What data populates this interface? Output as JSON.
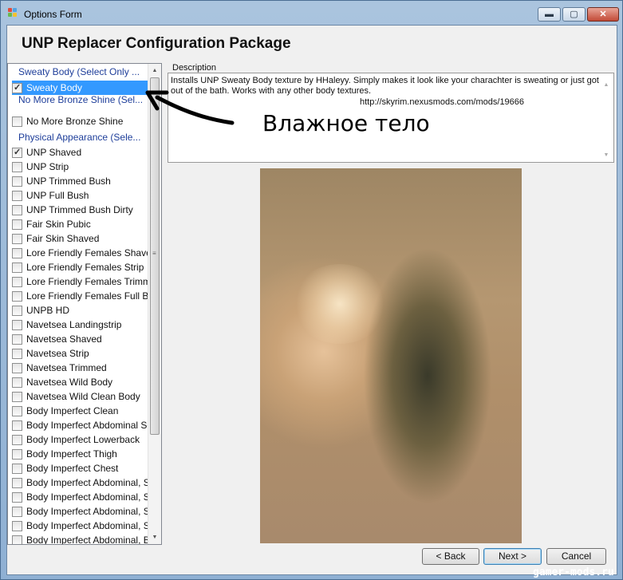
{
  "window": {
    "title": "Options Form",
    "controls": {
      "minimize": "▬",
      "maximize": "▢",
      "close": "✕"
    }
  },
  "form": {
    "title": "UNP Replacer Configuration Package"
  },
  "options_list": {
    "groups": [
      "Sweaty Body (Select Only ...",
      "No More Bronze Shine (Sel...",
      "Physical Appearance (Sele..."
    ],
    "items": [
      {
        "label": "Sweaty Body",
        "checked": true,
        "selected": true
      },
      {
        "label": "No More Bronze Shine",
        "checked": false
      },
      {
        "label": "UNP Shaved",
        "checked": true
      },
      {
        "label": "UNP Strip",
        "checked": false
      },
      {
        "label": "UNP Trimmed Bush",
        "checked": false
      },
      {
        "label": "UNP Full Bush",
        "checked": false
      },
      {
        "label": "UNP Trimmed Bush Dirty",
        "checked": false
      },
      {
        "label": "Fair Skin Pubic",
        "checked": false
      },
      {
        "label": "Fair Skin Shaved",
        "checked": false
      },
      {
        "label": "Lore Friendly Females Shaved",
        "checked": false
      },
      {
        "label": "Lore Friendly Females Strip",
        "checked": false
      },
      {
        "label": "Lore Friendly Females Trimme...",
        "checked": false
      },
      {
        "label": "Lore Friendly Females Full Bush",
        "checked": false
      },
      {
        "label": "UNPB HD",
        "checked": false
      },
      {
        "label": "Navetsea Landingstrip",
        "checked": false
      },
      {
        "label": "Navetsea Shaved",
        "checked": false
      },
      {
        "label": "Navetsea Strip",
        "checked": false
      },
      {
        "label": "Navetsea Trimmed",
        "checked": false
      },
      {
        "label": "Navetsea Wild Body",
        "checked": false
      },
      {
        "label": "Navetsea Wild Clean Body",
        "checked": false
      },
      {
        "label": "Body Imperfect Clean",
        "checked": false
      },
      {
        "label": "Body Imperfect Abdominal Scar",
        "checked": false
      },
      {
        "label": "Body Imperfect Lowerback",
        "checked": false
      },
      {
        "label": "Body Imperfect Thigh",
        "checked": false
      },
      {
        "label": "Body Imperfect Chest",
        "checked": false
      },
      {
        "label": "Body Imperfect Abdominal, S...",
        "checked": false
      },
      {
        "label": "Body Imperfect Abdominal, S...",
        "checked": false
      },
      {
        "label": "Body Imperfect Abdominal, S...",
        "checked": false
      },
      {
        "label": "Body Imperfect Abdominal, S...",
        "checked": false
      },
      {
        "label": "Body Imperfect Abdominal, B...",
        "checked": false
      }
    ]
  },
  "description": {
    "label": "Description",
    "text": "Installs UNP Sweaty Body texture by HHaleyy.  Simply makes it look like your charachter is sweating or just got out of the bath.  Works with any other body textures.",
    "url": "http://skyrim.nexusmods.com/mods/19666"
  },
  "annotation": {
    "text": "Влажное тело"
  },
  "buttons": {
    "back": "< Back",
    "next": "Next >",
    "cancel": "Cancel"
  },
  "watermark": "gamer-mods.ru"
}
